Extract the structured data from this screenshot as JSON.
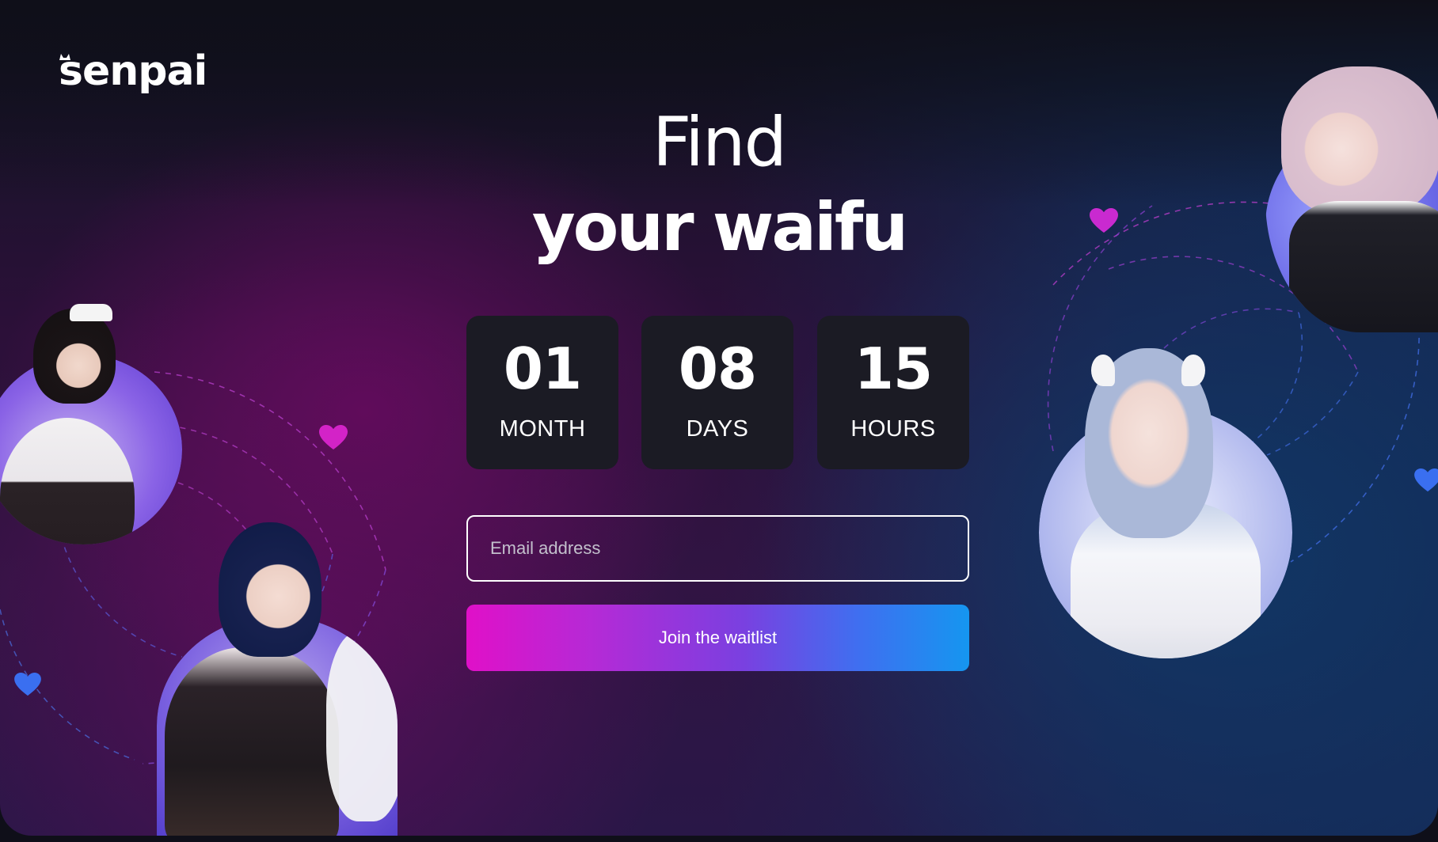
{
  "brand": {
    "logo_text": "senpai"
  },
  "hero": {
    "headline_line1": "Find",
    "headline_line2": "your waifu"
  },
  "countdown": [
    {
      "value": "01",
      "unit": "MONTH"
    },
    {
      "value": "08",
      "unit": "DAYS"
    },
    {
      "value": "15",
      "unit": "HOURS"
    }
  ],
  "form": {
    "email_placeholder": "Email address",
    "submit_label": "Join the waitlist"
  },
  "colors": {
    "heart_pink": "#d323c7",
    "heart_blue": "#3a6ff0",
    "button_gradient_start": "#e010c8",
    "button_gradient_end": "#1596f0",
    "counter_bg": "#1b1b24"
  }
}
